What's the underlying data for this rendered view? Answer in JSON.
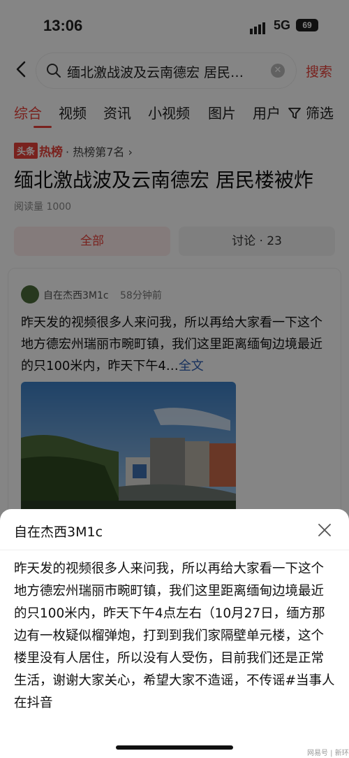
{
  "status": {
    "time": "13:06",
    "network": "5G",
    "battery": "69"
  },
  "search": {
    "query": "缅北激战波及云南德宏 居民…",
    "button_label": "搜索"
  },
  "tabs": [
    {
      "label": "综合",
      "active": true
    },
    {
      "label": "视频"
    },
    {
      "label": "资讯"
    },
    {
      "label": "小视频"
    },
    {
      "label": "图片"
    },
    {
      "label": "用户"
    },
    {
      "label": "筛选"
    }
  ],
  "hot": {
    "logo": "头条",
    "word": "热榜",
    "rank": "· 热榜第7名 ›"
  },
  "headline": "缅北激战波及云南德宏 居民楼被炸",
  "read_count": "阅读量 1000",
  "filters": {
    "all": "全部",
    "discuss": "讨论 · 23"
  },
  "post": {
    "author": "自在杰西3M1c",
    "time": "58分钟前",
    "excerpt": "昨天发的视频很多人来问我，所以再给大家看一下这个地方德宏州瑞丽市畹町镇，我们这里距离缅甸边境最近的只100米内，昨天下午4…",
    "full_link": "全文"
  },
  "sheet": {
    "title": "自在杰西3M1c",
    "body": "昨天发的视频很多人来问我，所以再给大家看一下这个地方德宏州瑞丽市畹町镇，我们这里距离缅甸边境最近的只100米内，昨天下午4点左右（10月27日，缅方那边有一枚疑似榴弹炮，打到到我们家隔壁单元楼，这个楼里没有人居住，所以没有人受伤，目前我们还是正常生活，谢谢大家关心，希望大家不造谣，不传谣#当事人在抖音"
  },
  "watermark": "网易号 | 新环",
  "colors": {
    "accent": "#e8413b",
    "link": "#2f5fb3"
  }
}
